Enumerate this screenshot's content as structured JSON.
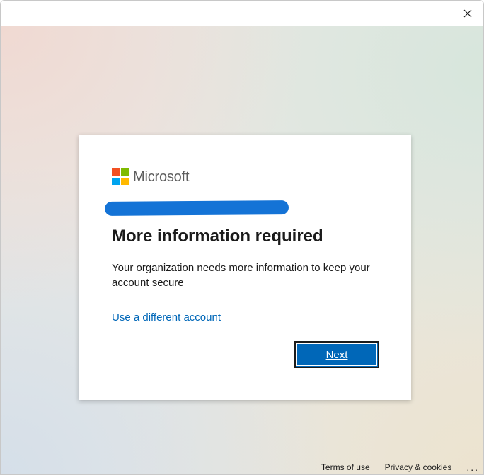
{
  "window": {
    "close_glyph": "✕"
  },
  "card": {
    "brand": "Microsoft",
    "logo_colors": [
      "#f25022",
      "#7fba00",
      "#00a4ef",
      "#ffb900"
    ],
    "redaction_color": "#1473d6",
    "heading": "More information required",
    "description": "Your organization needs more information to keep your account secure",
    "alt_link_label": "Use a different account",
    "next_button_label": "Next"
  },
  "footer": {
    "terms_label": "Terms of use",
    "privacy_label": "Privacy & cookies",
    "more_label": "..."
  },
  "colors": {
    "accent": "#0067b8",
    "text": "#1b1b1b"
  }
}
